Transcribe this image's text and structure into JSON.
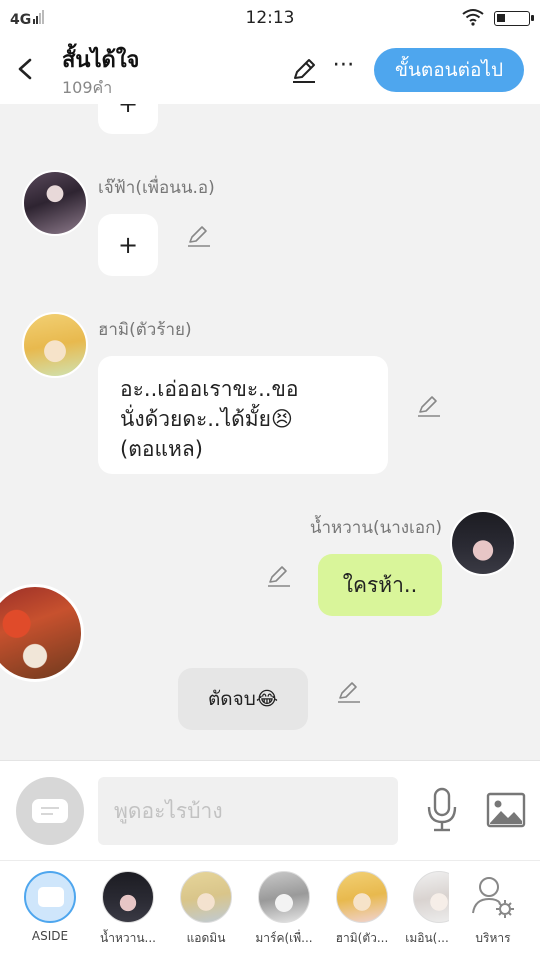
{
  "status_bar": {
    "network": "4G",
    "time": "12:13"
  },
  "header": {
    "title": "สั้นได้ใจ",
    "word_count": "109คำ",
    "next_button": "ขั้นตอนต่อไป"
  },
  "messages": [
    {
      "type": "plus",
      "content": "+"
    },
    {
      "speaker": "เจ๊ฟ้า(เพื่อนน.อ)",
      "content": "+"
    },
    {
      "speaker": "ฮามิ(ตัวร้าย)",
      "lines": [
        "อะ..เอ่ออเราขะ..ขอ",
        "นั่งด้วยดะ..ได้มั้ย😣",
        "(ตอแหล)"
      ]
    },
    {
      "speaker": "น้ำหวาน(นางเอก)",
      "content": "ใครห้า.."
    },
    {
      "type": "narration",
      "content": "ตัดจบ😂"
    }
  ],
  "input": {
    "placeholder": "พูดอะไรบ้าง"
  },
  "characters": [
    {
      "label": "ASIDE"
    },
    {
      "label": "น้ำหวาน..."
    },
    {
      "label": "แอดมิน"
    },
    {
      "label": "มาร์ค(เพื่..."
    },
    {
      "label": "ฮามิ(ตัว..."
    },
    {
      "label": "เมอิน(..."
    },
    {
      "label": "บริหาร"
    }
  ],
  "colors": {
    "accent": "#4ea6ee",
    "own_bubble": "#d9f59a",
    "narration_bubble": "#e6e6e6",
    "background": "#f2f2f2"
  }
}
